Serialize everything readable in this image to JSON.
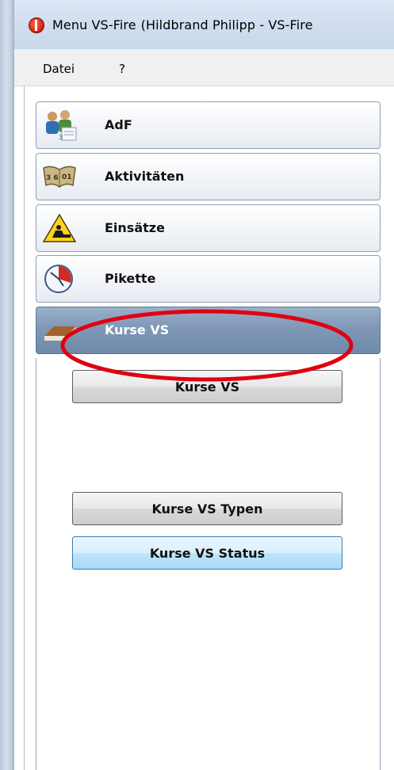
{
  "window": {
    "title": "Menu VS-Fire",
    "title_user": "(Hildbrand Philipp - VS-Fire"
  },
  "menubar": {
    "items": [
      {
        "label": "Datei"
      },
      {
        "label": "?"
      }
    ]
  },
  "nav": {
    "items": [
      {
        "label": "AdF",
        "icon": "people-icon"
      },
      {
        "label": "Aktivitäten",
        "icon": "book-icon"
      },
      {
        "label": "Einsätze",
        "icon": "warning-icon"
      },
      {
        "label": "Pikette",
        "icon": "clock-icon"
      },
      {
        "label": "Kurse VS",
        "icon": "book-closed-icon",
        "active": true
      }
    ]
  },
  "panel": {
    "buttons": [
      {
        "label": "Kurse VS"
      },
      {
        "label": "Kurse VS Typen"
      },
      {
        "label": "Kurse VS Status",
        "state": "hover"
      }
    ]
  },
  "colors": {
    "active_nav": "#7f98b6",
    "annotation": "#e0000f",
    "hover_button": "#bee6fd"
  }
}
